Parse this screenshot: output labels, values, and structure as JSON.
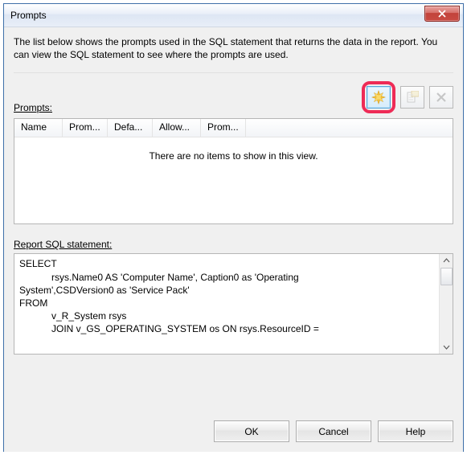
{
  "window": {
    "title": "Prompts"
  },
  "intro": "The list below shows the prompts used in the SQL statement that returns the data in the report. You can view the SQL statement to see where the prompts are used.",
  "prompts": {
    "label": "Prompts:",
    "columns": [
      "Name",
      "Prom...",
      "Defa...",
      "Allow...",
      "Prom..."
    ],
    "empty_text": "There are no items to show in this view."
  },
  "sql": {
    "label": "Report SQL statement:",
    "text": "SELECT\n            rsys.Name0 AS 'Computer Name', Caption0 as 'Operating\nSystem',CSDVersion0 as 'Service Pack'\nFROM\n            v_R_System rsys\n            JOIN v_GS_OPERATING_SYSTEM os ON rsys.ResourceID ="
  },
  "buttons": {
    "ok": "OK",
    "cancel": "Cancel",
    "help": "Help"
  },
  "icons": {
    "new": "new-starburst",
    "edit": "edit-properties",
    "delete": "delete-x"
  },
  "colors": {
    "highlight_ring": "#ee2b56",
    "titlebar_border": "#3e6fa8"
  }
}
